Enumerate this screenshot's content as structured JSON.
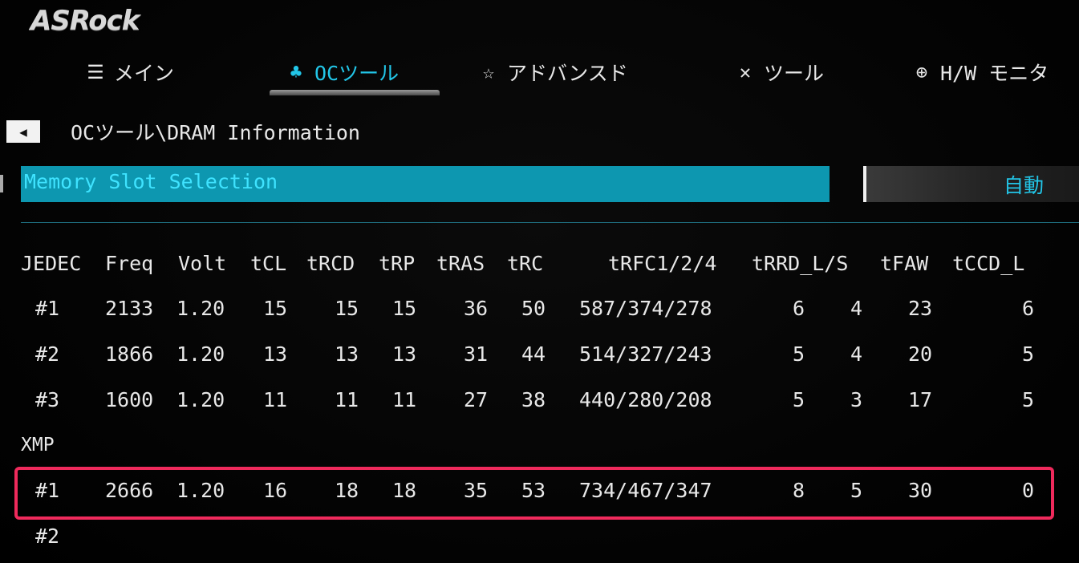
{
  "brand": {
    "logo": "ASRock"
  },
  "nav": {
    "tabs": [
      {
        "icon": "☰",
        "label": "メイン",
        "active": false
      },
      {
        "icon": "♣",
        "label": "OCツール",
        "active": true
      },
      {
        "icon": "☆",
        "label": "アドバンスド",
        "active": false
      },
      {
        "icon": "✕",
        "label": "ツール",
        "active": false
      },
      {
        "icon": "⊕",
        "label": "H/W モニタ",
        "active": false
      }
    ]
  },
  "breadcrumb": "OCツール\\DRAM Information",
  "option": {
    "label": "Memory Slot Selection",
    "value": "自動"
  },
  "table": {
    "columns": [
      "JEDEC",
      "Freq",
      "Volt",
      "tCL",
      "tRCD",
      "tRP",
      "tRAS",
      "tRC",
      "tRFC1/2/4",
      "tRRD_L/S",
      "tFAW",
      "tCCD_L"
    ],
    "jedec_rows": [
      {
        "id": "#1",
        "freq": "2133",
        "volt": "1.20",
        "tcl": "15",
        "trcd": "15",
        "trp": "15",
        "tras": "36",
        "trc": "50",
        "trfc": "587/374/278",
        "trrd_l": "6",
        "trrd_s": "4",
        "tfaw": "23",
        "tccd_l": "6"
      },
      {
        "id": "#2",
        "freq": "1866",
        "volt": "1.20",
        "tcl": "13",
        "trcd": "13",
        "trp": "13",
        "tras": "31",
        "trc": "44",
        "trfc": "514/327/243",
        "trrd_l": "5",
        "trrd_s": "4",
        "tfaw": "20",
        "tccd_l": "5"
      },
      {
        "id": "#3",
        "freq": "1600",
        "volt": "1.20",
        "tcl": "11",
        "trcd": "11",
        "trp": "11",
        "tras": "27",
        "trc": "38",
        "trfc": "440/280/208",
        "trrd_l": "5",
        "trrd_s": "3",
        "tfaw": "17",
        "tccd_l": "5"
      }
    ],
    "xmp_label": "XMP",
    "xmp_rows": [
      {
        "id": "#1",
        "freq": "2666",
        "volt": "1.20",
        "tcl": "16",
        "trcd": "18",
        "trp": "18",
        "tras": "35",
        "trc": "53",
        "trfc": "734/467/347",
        "trrd_l": "8",
        "trrd_s": "5",
        "tfaw": "30",
        "tccd_l": "0"
      },
      {
        "id": "#2"
      }
    ]
  },
  "colors": {
    "accent": "#22c6e8",
    "highlight_bar": "#0d97b0",
    "annotation_box": "#ef2a5c"
  }
}
